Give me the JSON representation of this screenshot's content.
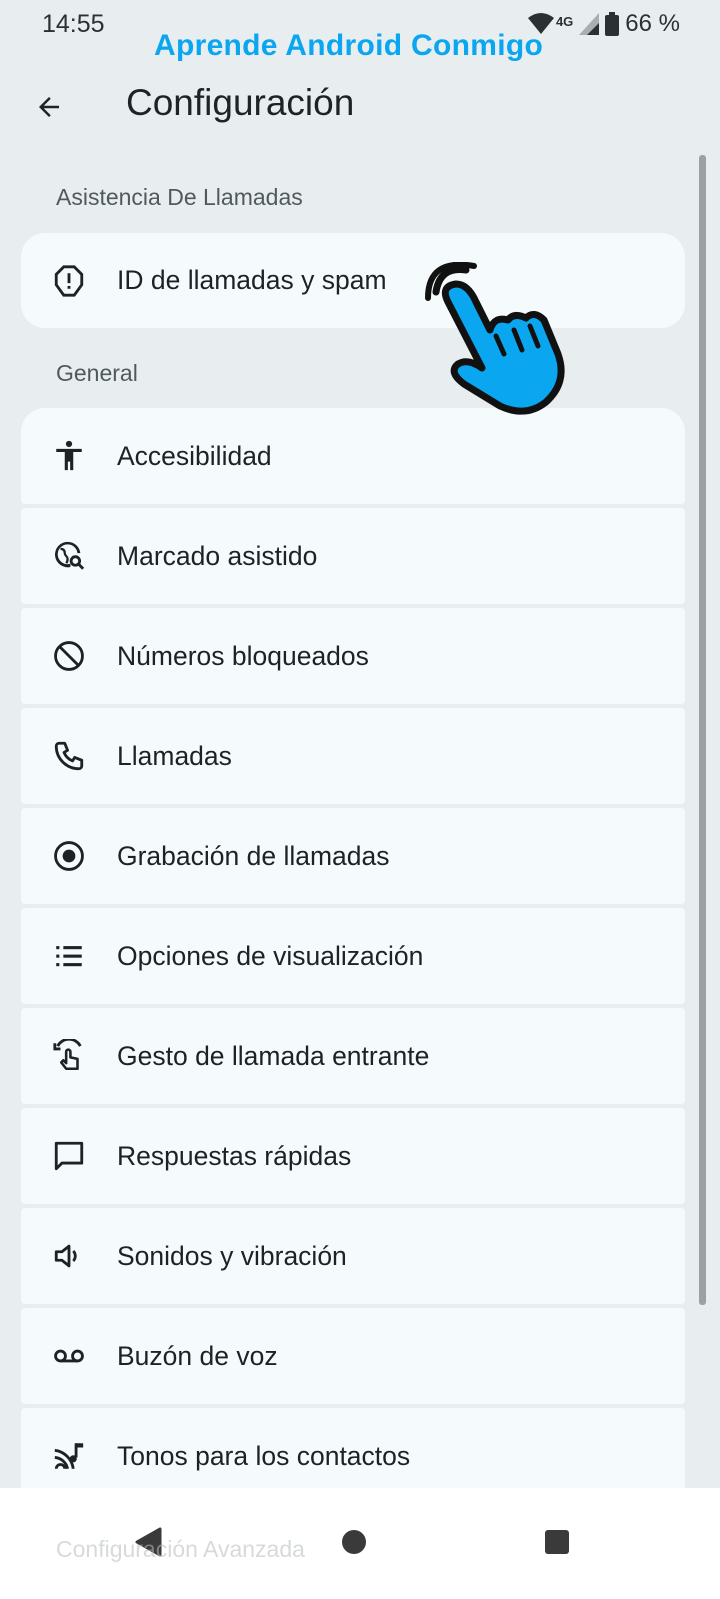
{
  "status_bar": {
    "time": "14:55",
    "network": "4G",
    "battery": "66 %"
  },
  "watermark": "Aprende Android Conmigo",
  "app_bar": {
    "title": "Configuración"
  },
  "sections": {
    "call_assist": {
      "header": "Asistencia De Llamadas",
      "item": {
        "label": "ID de llamadas y spam",
        "icon": "alert-octagon-icon"
      }
    },
    "general": {
      "header": "General",
      "items": [
        {
          "label": "Accesibilidad",
          "icon": "accessibility-icon"
        },
        {
          "label": "Marcado asistido",
          "icon": "globe-search-icon"
        },
        {
          "label": "Números bloqueados",
          "icon": "block-icon"
        },
        {
          "label": "Llamadas",
          "icon": "phone-icon"
        },
        {
          "label": "Grabación de llamadas",
          "icon": "record-icon"
        },
        {
          "label": "Opciones de visualización",
          "icon": "list-icon"
        },
        {
          "label": "Gesto de llamada entrante",
          "icon": "gesture-icon"
        },
        {
          "label": "Respuestas rápidas",
          "icon": "message-icon"
        },
        {
          "label": "Sonidos y vibración",
          "icon": "volume-icon"
        },
        {
          "label": "Buzón de voz",
          "icon": "voicemail-icon"
        },
        {
          "label": "Tonos para los contactos",
          "icon": "ringtone-icon"
        }
      ]
    },
    "advanced": {
      "header": "Configuración Avanzada"
    }
  },
  "colors": {
    "background": "#e8eef0",
    "card": "#f5fafc",
    "watermark": "#0aa6f0"
  }
}
